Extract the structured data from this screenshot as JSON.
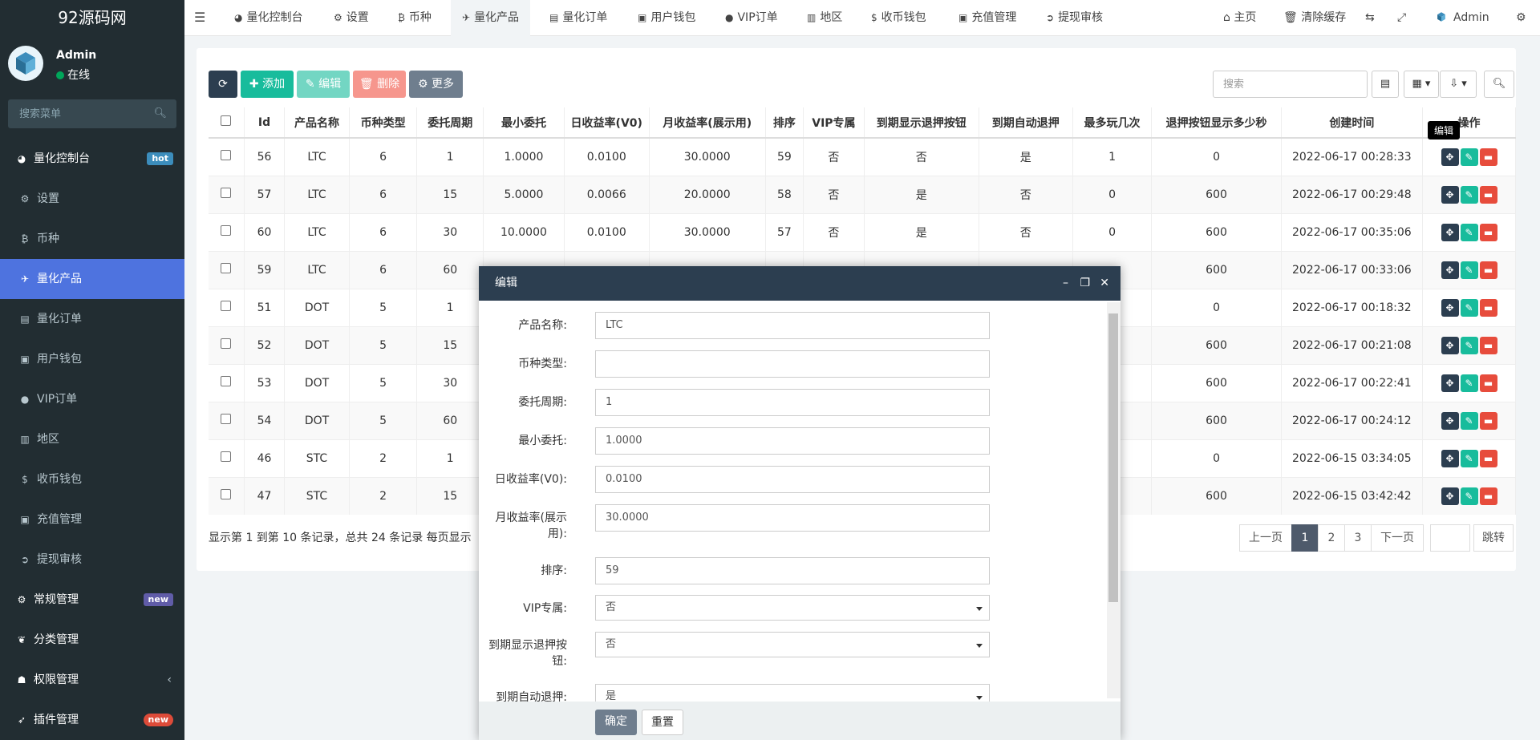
{
  "sidebar": {
    "brand": "92源码网",
    "user": {
      "name": "Admin",
      "status": "在线"
    },
    "search_placeholder": "搜索菜单",
    "items": [
      {
        "label": "量化控制台",
        "badge": "hot"
      },
      {
        "label": "设置"
      },
      {
        "label": "币种"
      },
      {
        "label": "量化产品"
      },
      {
        "label": "量化订单"
      },
      {
        "label": "用户钱包"
      },
      {
        "label": "VIP订单"
      },
      {
        "label": "地区"
      },
      {
        "label": "收币钱包"
      },
      {
        "label": "充值管理"
      },
      {
        "label": "提现审核"
      },
      {
        "label": "常规管理",
        "badge": "new"
      },
      {
        "label": "分类管理"
      },
      {
        "label": "权限管理"
      },
      {
        "label": "插件管理",
        "badge": "new"
      }
    ]
  },
  "topnav": {
    "tabs": [
      "量化控制台",
      "设置",
      "币种",
      "量化产品",
      "量化订单",
      "用户钱包",
      "VIP订单",
      "地区",
      "收币钱包",
      "充值管理",
      "提现审核"
    ],
    "home": "主页",
    "clear_cache": "清除缓存",
    "admin": "Admin"
  },
  "toolbar": {
    "add": "添加",
    "edit": "编辑",
    "delete": "删除",
    "more": "更多",
    "search_placeholder": "搜索"
  },
  "table": {
    "columns": [
      "Id",
      "产品名称",
      "币种类型",
      "委托周期",
      "最小委托",
      "日收益率(V0)",
      "月收益率(展示用)",
      "排序",
      "VIP专属",
      "到期显示退押按钮",
      "到期自动退押",
      "最多玩几次",
      "退押按钮显示多少秒",
      "创建时间",
      "操作"
    ],
    "rows": [
      [
        "56",
        "LTC",
        "6",
        "1",
        "1.0000",
        "0.0100",
        "30.0000",
        "59",
        "否",
        "否",
        "是",
        "1",
        "0",
        "2022-06-17 00:28:33"
      ],
      [
        "57",
        "LTC",
        "6",
        "15",
        "5.0000",
        "0.0066",
        "20.0000",
        "58",
        "否",
        "是",
        "否",
        "0",
        "600",
        "2022-06-17 00:29:48"
      ],
      [
        "60",
        "LTC",
        "6",
        "30",
        "10.0000",
        "0.0100",
        "30.0000",
        "57",
        "否",
        "是",
        "否",
        "0",
        "600",
        "2022-06-17 00:35:06"
      ],
      [
        "59",
        "LTC",
        "6",
        "60",
        "",
        "",
        "",
        "",
        "",
        "",
        "",
        "",
        "600",
        "2022-06-17 00:33:06"
      ],
      [
        "51",
        "DOT",
        "5",
        "1",
        "",
        "",
        "",
        "",
        "",
        "",
        "",
        "",
        "0",
        "2022-06-17 00:18:32"
      ],
      [
        "52",
        "DOT",
        "5",
        "15",
        "",
        "",
        "",
        "",
        "",
        "",
        "",
        "",
        "600",
        "2022-06-17 00:21:08"
      ],
      [
        "53",
        "DOT",
        "5",
        "30",
        "",
        "",
        "",
        "",
        "",
        "",
        "",
        "",
        "600",
        "2022-06-17 00:22:41"
      ],
      [
        "54",
        "DOT",
        "5",
        "60",
        "",
        "",
        "",
        "",
        "",
        "",
        "",
        "",
        "600",
        "2022-06-17 00:24:12"
      ],
      [
        "46",
        "STC",
        "2",
        "1",
        "",
        "",
        "",
        "",
        "",
        "",
        "",
        "",
        "0",
        "2022-06-15 03:34:05"
      ],
      [
        "47",
        "STC",
        "2",
        "15",
        "",
        "",
        "",
        "",
        "",
        "",
        "",
        "",
        "600",
        "2022-06-15 03:42:42"
      ]
    ],
    "tooltip": "编辑"
  },
  "pagination": {
    "info": "显示第 1 到第 10 条记录，总共 24 条记录 每页显示",
    "prev": "上一页",
    "pages": [
      "1",
      "2",
      "3"
    ],
    "next": "下一页",
    "jump": "跳转"
  },
  "modal": {
    "title": "编辑",
    "fields": [
      {
        "label": "产品名称:",
        "value": "LTC"
      },
      {
        "label": "币种类型:",
        "value": ""
      },
      {
        "label": "委托周期:",
        "value": "1"
      },
      {
        "label": "最小委托:",
        "value": "1.0000"
      },
      {
        "label": "日收益率(V0):",
        "value": "0.0100"
      },
      {
        "label": "月收益率(展示用):",
        "value": "30.0000"
      },
      {
        "label": "排序:",
        "value": "59"
      },
      {
        "label": "VIP专属:",
        "value": "否"
      },
      {
        "label": "到期显示退押按钮:",
        "value": "否"
      },
      {
        "label": "到期自动退押:",
        "value": "是"
      }
    ],
    "ok": "确定",
    "reset": "重置"
  },
  "colors": {
    "sidebar_bg": "#222d32",
    "active": "#4e73df",
    "green": "#18bc9c",
    "modal_head": "#2c3e50"
  }
}
